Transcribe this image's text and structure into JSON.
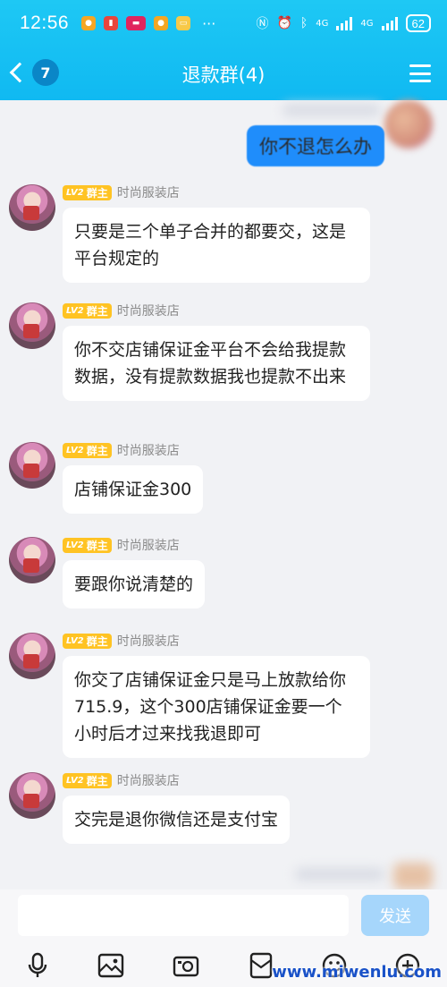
{
  "status_bar": {
    "time": "12:56",
    "network": "4G",
    "battery": "62"
  },
  "header": {
    "unread_count": "7",
    "title": "退款群(4)"
  },
  "my_message": {
    "text": "你不退怎么办"
  },
  "member": {
    "level": "LV2",
    "role": "群主",
    "name": "时尚服装店"
  },
  "messages": [
    {
      "text": "只要是三个单子合并的都要交，这是平台规定的"
    },
    {
      "text": "你不交店铺保证金平台不会给我提款数据，没有提款数据我也提款不出来"
    },
    {
      "text": "店铺保证金300"
    },
    {
      "text": "要跟你说清楚的"
    },
    {
      "text": "你交了店铺保证金只是马上放款给你715.9，这个300店铺保证金要一个小时后才过来找我退即可"
    },
    {
      "text": "交完是退你微信还是支付宝"
    }
  ],
  "input": {
    "placeholder": "",
    "send_label": "发送"
  },
  "toolbar": {
    "icons": [
      "microphone-icon",
      "image-icon",
      "camera-icon",
      "red-packet-icon",
      "emoji-icon",
      "plus-icon"
    ]
  },
  "watermark": {
    "text": "www.miwenlu.com"
  },
  "colors": {
    "header": "#10b9f2",
    "my_bubble": "#1f8dfb",
    "tag": "#ffc323",
    "badge": "#0a86c7"
  }
}
